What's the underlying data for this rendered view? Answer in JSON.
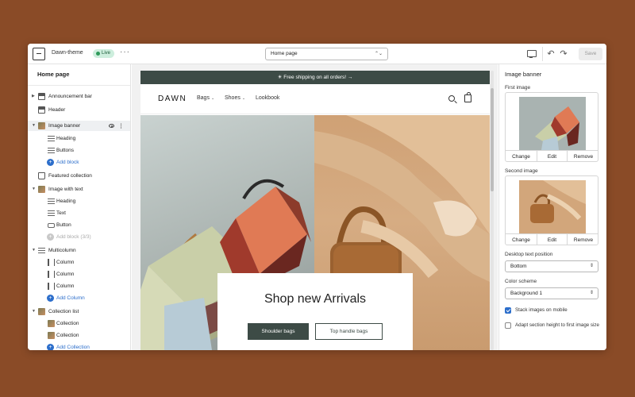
{
  "topbar": {
    "theme_name": "Dawn-theme",
    "live_badge": "Live",
    "more_label": "···",
    "page_select": "Home page",
    "save_label": "Save"
  },
  "sidebar": {
    "title": "Home page",
    "items": [
      {
        "label": "Announcement bar"
      },
      {
        "label": "Header"
      },
      {
        "label": "Image banner"
      },
      {
        "label": "Heading"
      },
      {
        "label": "Buttons"
      },
      {
        "label": "Add block"
      },
      {
        "label": "Featured collection"
      },
      {
        "label": "Image with text"
      },
      {
        "label": "Heading"
      },
      {
        "label": "Text"
      },
      {
        "label": "Button"
      },
      {
        "label": "Add block (3/3)"
      },
      {
        "label": "Multicolumn"
      },
      {
        "label": "Column"
      },
      {
        "label": "Column"
      },
      {
        "label": "Column"
      },
      {
        "label": "Add Column"
      },
      {
        "label": "Collection list"
      },
      {
        "label": "Collection"
      },
      {
        "label": "Collection"
      },
      {
        "label": "Add Collection"
      }
    ]
  },
  "preview": {
    "announcement": "☀ Free shipping on all orders!  →",
    "logo": "DAWN",
    "nav": [
      "Bags",
      "Shoes",
      "Lookbook"
    ],
    "banner_heading": "Shop new Arrivals",
    "button_primary": "Shoulder bags",
    "button_secondary": "Top handle bags"
  },
  "panel": {
    "title": "Image banner",
    "first_image_label": "First image",
    "second_image_label": "Second image",
    "actions": [
      "Change",
      "Edit",
      "Remove"
    ],
    "desktop_text_position_label": "Desktop text position",
    "desktop_text_position_value": "Bottom",
    "color_scheme_label": "Color scheme",
    "color_scheme_value": "Background 1",
    "stack_images_label": "Stack images on mobile",
    "stack_images_checked": true,
    "adapt_height_label": "Adapt section height to first image size",
    "adapt_height_checked": false
  },
  "colors": {
    "background": "#8a4b27",
    "accent": "#2c6ecb",
    "brand_dark": "#3d4b46",
    "live_green": "#2e9a5a"
  }
}
